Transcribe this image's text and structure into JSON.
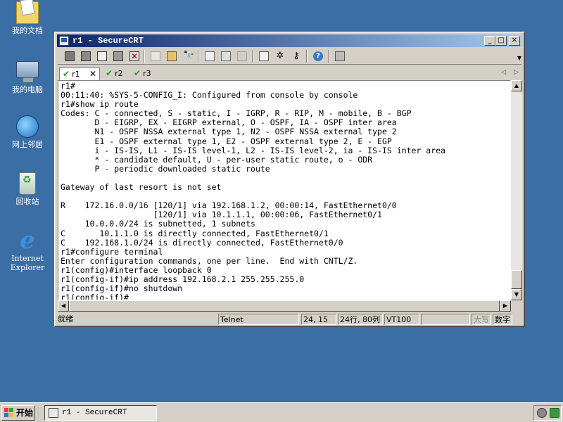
{
  "desktop": {
    "icons": [
      {
        "label": "我的文档"
      },
      {
        "label": "我的电脑"
      },
      {
        "label": "网上邻居"
      },
      {
        "label": "回收站"
      },
      {
        "label": "Internet Explorer"
      }
    ]
  },
  "window": {
    "title": "r1 - SecureCRT",
    "controls": {
      "minimize": "_",
      "maximize": "□",
      "close": "✕"
    }
  },
  "toolbar": {
    "icons": [
      "connect-icon",
      "quick-connect-icon",
      "connect-in-tab-icon",
      "reconnect-icon",
      "disconnect-icon",
      "copy-icon",
      "paste-icon",
      "find-icon",
      "print-setup-icon",
      "print-selection-icon",
      "print-icon",
      "session-options-icon",
      "global-options-icon",
      "key-icon",
      "help-icon",
      "extra-icon"
    ]
  },
  "tabs": [
    {
      "label": "r1",
      "close": "✕",
      "active": true
    },
    {
      "label": "r2",
      "active": false
    },
    {
      "label": "r3",
      "active": false
    }
  ],
  "tab_nav": {
    "prev": "◁",
    "next": "▷"
  },
  "terminal": {
    "lines": [
      "r1#",
      "00:11:40: %SYS-5-CONFIG_I: Configured from console by console",
      "r1#show ip route",
      "Codes: C - connected, S - static, I - IGRP, R - RIP, M - mobile, B - BGP",
      "       D - EIGRP, EX - EIGRP external, O - OSPF, IA - OSPF inter area",
      "       N1 - OSPF NSSA external type 1, N2 - OSPF NSSA external type 2",
      "       E1 - OSPF external type 1, E2 - OSPF external type 2, E - EGP",
      "       i - IS-IS, L1 - IS-IS level-1, L2 - IS-IS level-2, ia - IS-IS inter area",
      "       * - candidate default, U - per-user static route, o - ODR",
      "       P - periodic downloaded static route",
      "",
      "Gateway of last resort is not set",
      "",
      "R    172.16.0.0/16 [120/1] via 192.168.1.2, 00:00:14, FastEthernet0/0",
      "                   [120/1] via 10.1.1.1, 00:00:06, FastEthernet0/1",
      "     10.0.0.0/24 is subnetted, 1 subnets",
      "C       10.1.1.0 is directly connected, FastEthernet0/1",
      "C    192.168.1.0/24 is directly connected, FastEthernet0/0",
      "r1#configure terminal",
      "Enter configuration commands, one per line.  End with CNTL/Z.",
      "r1(config)#interface loopback 0",
      "r1(config-if)#ip address 192.168.2.1 255.255.255.0",
      "r1(config-if)#no shutdown",
      "r1(config-if)#"
    ]
  },
  "scroll": {
    "up": "▲",
    "down": "▼",
    "left": "◀",
    "right": "▶"
  },
  "statusbar": {
    "ready": "就绪",
    "protocol": "Telnet",
    "cursor": "24, 15",
    "size": "24行, 80列",
    "emulation": "VT100",
    "caps": "大写",
    "num": "数字"
  },
  "taskbar": {
    "start_label": "开始",
    "task_title": "r1 - SecureCRT"
  }
}
